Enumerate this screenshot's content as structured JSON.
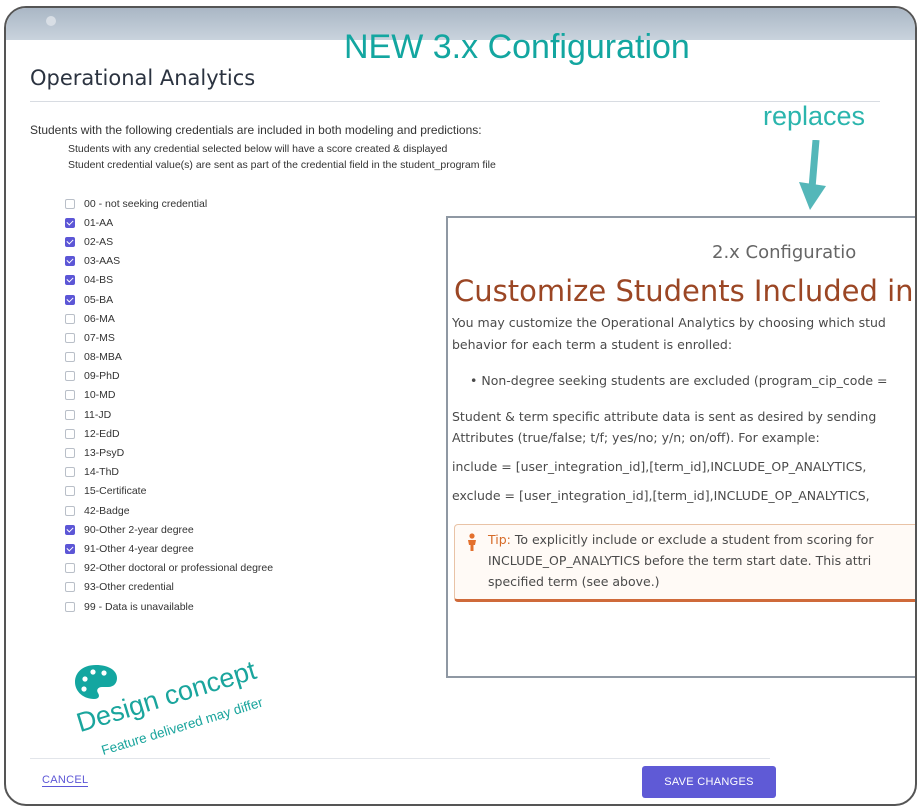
{
  "screen_title": "Operational Analytics",
  "overlay": {
    "new_label": "NEW 3.x Configuration",
    "replaces_label": "replaces",
    "design_concept": "Design concept",
    "feature_note": "Feature delivered may differ"
  },
  "intro": "Students with the following credentials are included in both modeling and predictions:",
  "sub_lines": [
    "Students with any credential selected below will have a score created & displayed",
    "Student credential value(s) are sent as part of the credential field in the student_program file"
  ],
  "credentials": [
    {
      "label": "00 - not seeking credential",
      "checked": false
    },
    {
      "label": "01-AA",
      "checked": true
    },
    {
      "label": "02-AS",
      "checked": true
    },
    {
      "label": "03-AAS",
      "checked": true
    },
    {
      "label": "04-BS",
      "checked": true
    },
    {
      "label": "05-BA",
      "checked": true
    },
    {
      "label": "06-MA",
      "checked": false
    },
    {
      "label": "07-MS",
      "checked": false
    },
    {
      "label": "08-MBA",
      "checked": false
    },
    {
      "label": "09-PhD",
      "checked": false
    },
    {
      "label": "10-MD",
      "checked": false
    },
    {
      "label": "11-JD",
      "checked": false
    },
    {
      "label": "12-EdD",
      "checked": false
    },
    {
      "label": "13-PsyD",
      "checked": false
    },
    {
      "label": "14-ThD",
      "checked": false
    },
    {
      "label": "15-Certificate",
      "checked": false
    },
    {
      "label": "42-Badge",
      "checked": false
    },
    {
      "label": "90-Other 2-year degree",
      "checked": true
    },
    {
      "label": "91-Other 4-year degree",
      "checked": true
    },
    {
      "label": "92-Other doctoral or professional degree",
      "checked": false
    },
    {
      "label": "93-Other credential",
      "checked": false
    },
    {
      "label": "99 - Data is unavailable",
      "checked": false
    }
  ],
  "footer": {
    "cancel": "CANCEL",
    "save": "SAVE CHANGES"
  },
  "old_panel": {
    "subtitle": "2.x Configuratio",
    "title": "Customize Students Included in",
    "para1": "You may customize the Operational Analytics by choosing which stud",
    "para2": "behavior for each term a student is enrolled:",
    "bullet": "Non-degree seeking students are excluded (program_cip_code =",
    "para3": "Student & term specific attribute data is sent as desired by sending",
    "para4": "Attributes (true/false; t/f; yes/no; y/n; on/off). For example:",
    "include": "include = [user_integration_id],[term_id],INCLUDE_OP_ANALYTICS,",
    "exclude": "exclude = [user_integration_id],[term_id],INCLUDE_OP_ANALYTICS,",
    "tip_label": "Tip:",
    "tip_line1": " To explicitly include or exclude a student from scoring for",
    "tip_line2": "INCLUDE_OP_ANALYTICS before the term start date. This attri",
    "tip_line3": "specified term (see above.)"
  },
  "colors": {
    "accent": "#5c56d6",
    "teal": "#13a6a0",
    "brown_title": "#9b4624",
    "tip_orange": "#d66a27"
  }
}
